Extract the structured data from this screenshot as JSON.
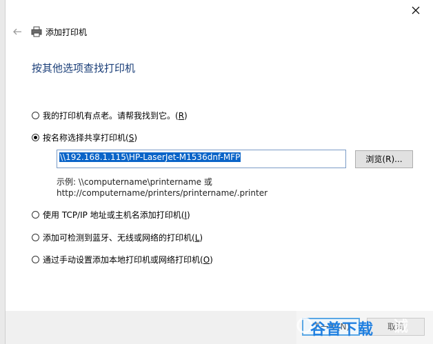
{
  "window": {
    "title": "添加打印机"
  },
  "heading": "按其他选项查找打印机",
  "options": [
    {
      "label": "我的打印机有点老。请帮我找到它。",
      "key": "R",
      "selected": false
    },
    {
      "label": "按名称选择共享打印机",
      "key": "S",
      "selected": true
    },
    {
      "label": "使用 TCP/IP 地址或主机名添加打印机",
      "key": "I",
      "selected": false
    },
    {
      "label": "添加可检测到蓝牙、无线或网络的打印机",
      "key": "L",
      "selected": false
    },
    {
      "label": "通过手动设置添加本地打印机或网络打印机",
      "key": "O",
      "selected": false
    }
  ],
  "shared_printer": {
    "path_value": "\\\\192.168.1.115\\HP-LaserJet-M1536dnf-MFP",
    "browse_label": "浏览(R)...",
    "example_line1": "示例: \\\\computername\\printername 或",
    "example_line2": "http://computername/printers/printername/.printer"
  },
  "footer": {
    "next_label": "下一步(N)",
    "cancel_label": "取消"
  },
  "watermark": {
    "text": "谷普下载",
    "text2": "诚"
  },
  "colors": {
    "heading": "#1a3e78",
    "selection": "#0a64c8",
    "accent": "#0078d7"
  }
}
